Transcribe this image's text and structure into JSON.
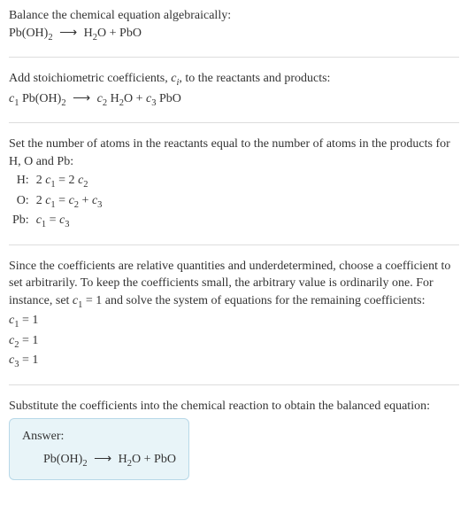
{
  "section1": {
    "title": "Balance the chemical equation algebraically:",
    "eq_left": "Pb(OH)",
    "eq_left_sub": "2",
    "arrow": "⟶",
    "eq_r1": "H",
    "eq_r1_sub": "2",
    "eq_r1b": "O + PbO"
  },
  "section2": {
    "text_a": "Add stoichiometric coefficients, ",
    "ci": "c",
    "ci_sub": "i",
    "text_b": ", to the reactants and products:",
    "c1": "c",
    "c1_sub": "1",
    "sp1": " Pb(OH)",
    "sp1_sub": "2",
    "arrow": "⟶",
    "c2": "c",
    "c2_sub": "2",
    "sp2": " H",
    "sp2_sub": "2",
    "sp2b": "O + ",
    "c3": "c",
    "c3_sub": "3",
    "sp3": " PbO"
  },
  "section3": {
    "text": "Set the number of atoms in the reactants equal to the number of atoms in the products for H, O and Pb:",
    "rows": {
      "h_label": "H:",
      "h_eq_a": "2 ",
      "h_eq_c1": "c",
      "h_eq_c1s": "1",
      "h_eq_b": " = 2 ",
      "h_eq_c2": "c",
      "h_eq_c2s": "2",
      "o_label": "O:",
      "o_eq_a": "2 ",
      "o_eq_c1": "c",
      "o_eq_c1s": "1",
      "o_eq_b": " = ",
      "o_eq_c2": "c",
      "o_eq_c2s": "2",
      "o_eq_c": " + ",
      "o_eq_c3": "c",
      "o_eq_c3s": "3",
      "pb_label": "Pb:",
      "pb_eq_c1": "c",
      "pb_eq_c1s": "1",
      "pb_eq_b": " = ",
      "pb_eq_c3": "c",
      "pb_eq_c3s": "3"
    }
  },
  "section4": {
    "text_a": "Since the coefficients are relative quantities and underdetermined, choose a coefficient to set arbitrarily. To keep the coefficients small, the arbitrary value is ordinarily one. For instance, set ",
    "c1": "c",
    "c1_sub": "1",
    "text_b": " = 1 and solve the system of equations for the remaining coefficients:",
    "l1a": "c",
    "l1s": "1",
    "l1b": " = 1",
    "l2a": "c",
    "l2s": "2",
    "l2b": " = 1",
    "l3a": "c",
    "l3s": "3",
    "l3b": " = 1"
  },
  "section5": {
    "text": "Substitute the coefficients into the chemical reaction to obtain the balanced equation:",
    "answer_label": "Answer:",
    "eq_left": "Pb(OH)",
    "eq_left_sub": "2",
    "arrow": "⟶",
    "eq_r1": "H",
    "eq_r1_sub": "2",
    "eq_r1b": "O + PbO"
  }
}
